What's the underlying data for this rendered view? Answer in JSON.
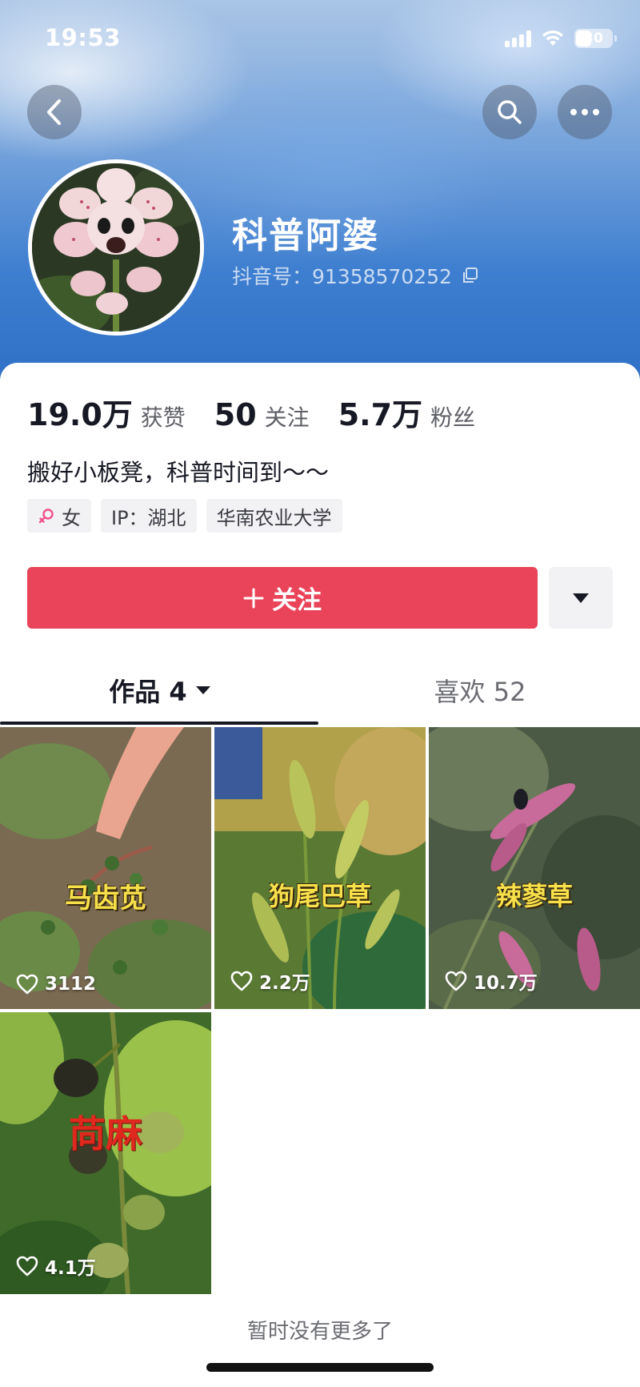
{
  "status_bar": {
    "time": "19:53",
    "battery": "30"
  },
  "header": {
    "back_icon": "chevron-left-icon",
    "search_icon": "search-icon",
    "more_icon": "more-dots-icon"
  },
  "profile": {
    "nickname": "科普阿婆",
    "douyin_id": "抖音号：91358570252",
    "stats": [
      {
        "value": "19.0万",
        "label": "获赞"
      },
      {
        "value": "50",
        "label": "关注"
      },
      {
        "value": "5.7万",
        "label": "粉丝"
      }
    ],
    "bio": "搬好小板凳，科普时间到～～",
    "tags": {
      "gender": "女",
      "ip": "IP：湖北",
      "school": "华南农业大学"
    },
    "follow_label": "关注"
  },
  "tabs": {
    "works": "作品 4",
    "likes": "喜欢 52"
  },
  "videos": [
    {
      "title": "马齿苋",
      "likes": "3112"
    },
    {
      "title": "狗尾巴草",
      "likes": "2.2万"
    },
    {
      "title": "辣蓼草",
      "likes": "10.7万"
    },
    {
      "title": "苘麻",
      "likes": "4.1万"
    }
  ],
  "footer": {
    "end_text": "暂时没有更多了"
  },
  "colors": {
    "accent": "#ea445a",
    "title_yellow": "#f7e04a",
    "title_red": "#e0281e"
  }
}
